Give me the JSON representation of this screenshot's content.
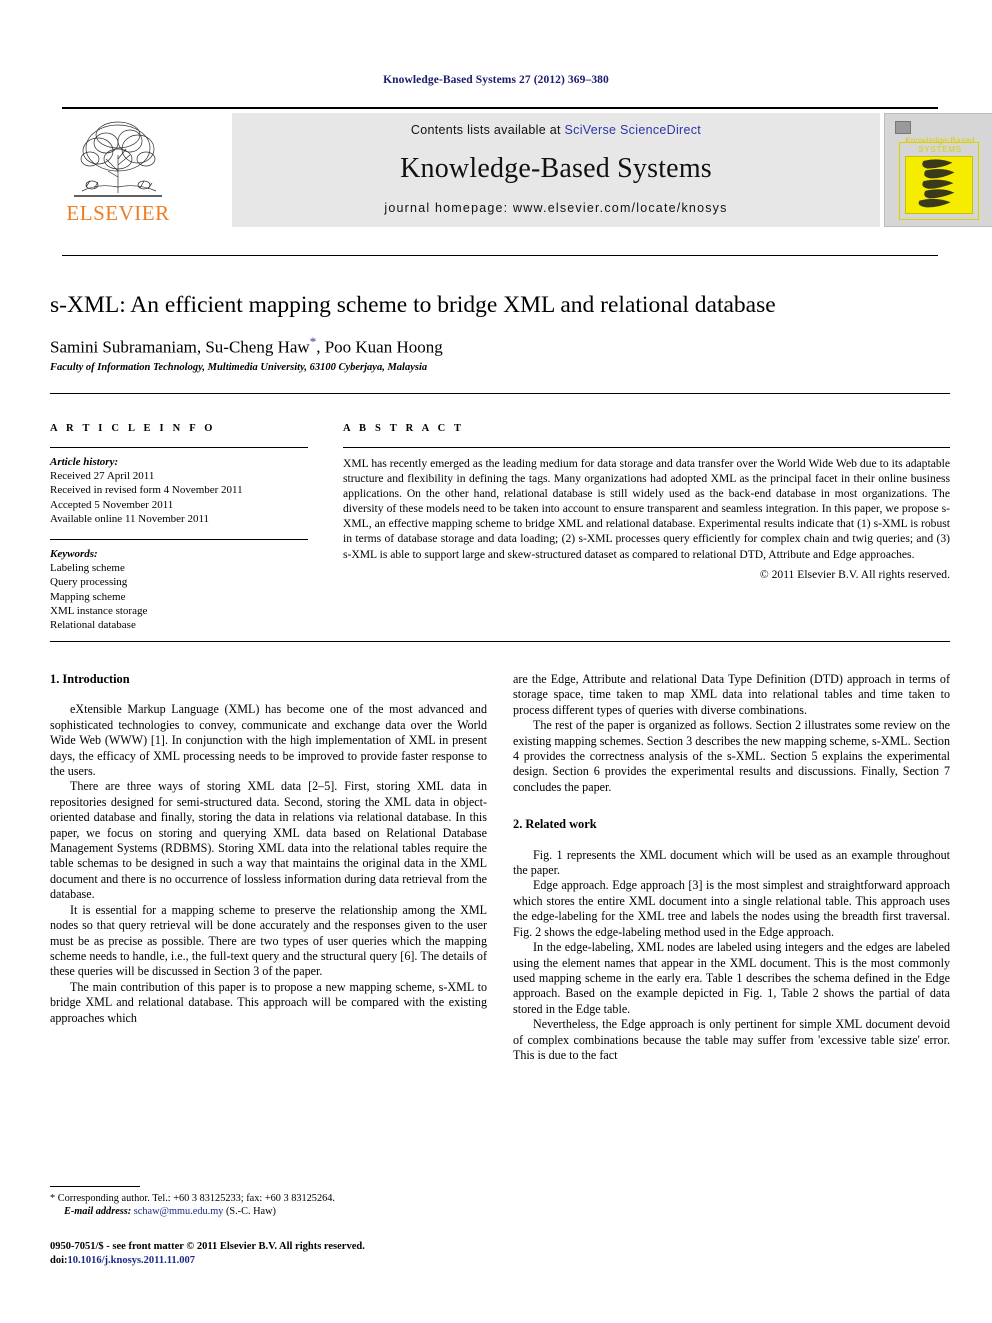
{
  "running_head": "Knowledge-Based Systems 27 (2012) 369–380",
  "masthead": {
    "contents_prefix": "Contents lists available at ",
    "sciencedirect_link": "SciVerse ScienceDirect",
    "journal_title": "Knowledge-Based Systems",
    "journal_homepage": "journal homepage: www.elsevier.com/locate/knosys",
    "publisher_logo_text": "ELSEVIER",
    "cover": {
      "line1": "Knowledge-Based",
      "line2": "SYSTEMS"
    }
  },
  "article": {
    "title": "s-XML: An efficient mapping scheme to bridge XML and relational database",
    "authors": "Samini Subramaniam, Su-Cheng Haw",
    "authors_after_star": ", Poo Kuan Hoong",
    "corresponding_marker": "*",
    "affiliation": "Faculty of Information Technology, Multimedia University, 63100 Cyberjaya, Malaysia"
  },
  "section_labels": {
    "article_info": "A R T I C L E  I N F O",
    "abstract": "A B S T R A C T"
  },
  "article_info": {
    "history_label": "Article history:",
    "history": [
      "Received 27 April 2011",
      "Received in revised form 4 November 2011",
      "Accepted 5 November 2011",
      "Available online 11 November 2011"
    ],
    "keywords_label": "Keywords:",
    "keywords": [
      "Labeling scheme",
      "Query processing",
      "Mapping scheme",
      "XML instance storage",
      "Relational database"
    ]
  },
  "abstract": {
    "text": "XML has recently emerged as the leading medium for data storage and data transfer over the World Wide Web due to its adaptable structure and flexibility in defining the tags. Many organizations had adopted XML as the principal facet in their online business applications. On the other hand, relational database is still widely used as the back-end database in most organizations. The diversity of these models need to be taken into account to ensure transparent and seamless integration. In this paper, we propose s-XML, an effective mapping scheme to bridge XML and relational database. Experimental results indicate that (1) s-XML is robust in terms of database storage and data loading; (2) s-XML processes query efficiently for complex chain and twig queries; and (3) s-XML is able to support large and skew-structured dataset as compared to relational DTD, Attribute and Edge approaches.",
    "copyright": "© 2011 Elsevier B.V. All rights reserved."
  },
  "body": {
    "left": {
      "heading": "1. Introduction",
      "paragraphs": [
        "eXtensible Markup Language (XML) has become one of the most advanced and sophisticated technologies to convey, communicate and exchange data over the World Wide Web (WWW) [1]. In conjunction with the high implementation of XML in present days, the efficacy of XML processing needs to be improved to provide faster response to the users.",
        "There are three ways of storing XML data [2–5]. First, storing XML data in repositories designed for semi-structured data. Second, storing the XML data in object-oriented database and finally, storing the data in relations via relational database. In this paper, we focus on storing and querying XML data based on Relational Database Management Systems (RDBMS). Storing XML data into the relational tables require the table schemas to be designed in such a way that maintains the original data in the XML document and there is no occurrence of lossless information during data retrieval from the database.",
        "It is essential for a mapping scheme to preserve the relationship among the XML nodes so that query retrieval will be done accurately and the responses given to the user must be as precise as possible. There are two types of user queries which the mapping scheme needs to handle, i.e., the full-text query and the structural query [6]. The details of these queries will be discussed in Section 3 of the paper.",
        "The main contribution of this paper is to propose a new mapping scheme, s-XML to bridge XML and relational database. This approach will be compared with the existing approaches which"
      ]
    },
    "right": {
      "continuation": "are the Edge, Attribute and relational Data Type Definition (DTD) approach in terms of storage space, time taken to map XML data into relational tables and time taken to process different types of queries with diverse combinations.",
      "organization": "The rest of the paper is organized as follows. Section 2 illustrates some review on the existing mapping schemes. Section 3 describes the new mapping scheme, s-XML. Section 4 provides the correctness analysis of the s-XML. Section 5 explains the experimental design. Section 6 provides the experimental results and discussions. Finally, Section 7 concludes the paper.",
      "heading": "2. Related work",
      "paragraphs": [
        "Fig. 1 represents the XML document which will be used as an example throughout the paper.",
        "Edge approach. Edge approach [3] is the most simplest and straightforward approach which stores the entire XML document into a single relational table. This approach uses the edge-labeling for the XML tree and labels the nodes using the breadth first traversal. Fig. 2 shows the edge-labeling method used in the Edge approach.",
        "In the edge-labeling, XML nodes are labeled using integers and the edges are labeled using the element names that appear in the XML document. This is the most commonly used mapping scheme in the early era. Table 1 describes the schema defined in the Edge approach. Based on the example depicted in Fig. 1, Table 2 shows the partial of data stored in the Edge table.",
        "Nevertheless, the Edge approach is only pertinent for simple XML document devoid of complex combinations because the table may suffer from 'excessive table size' error. This is due to the fact"
      ]
    }
  },
  "footnote": {
    "corresponding": "* Corresponding author. Tel.: +60 3 83125233; fax: +60 3 83125264.",
    "email_label": "E-mail address:",
    "email": "schaw@mmu.edu.my",
    "email_suffix": "(S.-C. Haw)"
  },
  "imprint": {
    "line1": "0950-7051/$ - see front matter © 2011 Elsevier B.V. All rights reserved.",
    "doi_label": "doi:",
    "doi_value": "10.1016/j.knosys.2011.11.007"
  },
  "colors": {
    "link": "#1a2a8a",
    "sciencedirect": "#2b36a8",
    "elsevier_orange": "#f07c21",
    "panel_gray": "#e7e7e7",
    "running_head": "#1a1a6e"
  }
}
